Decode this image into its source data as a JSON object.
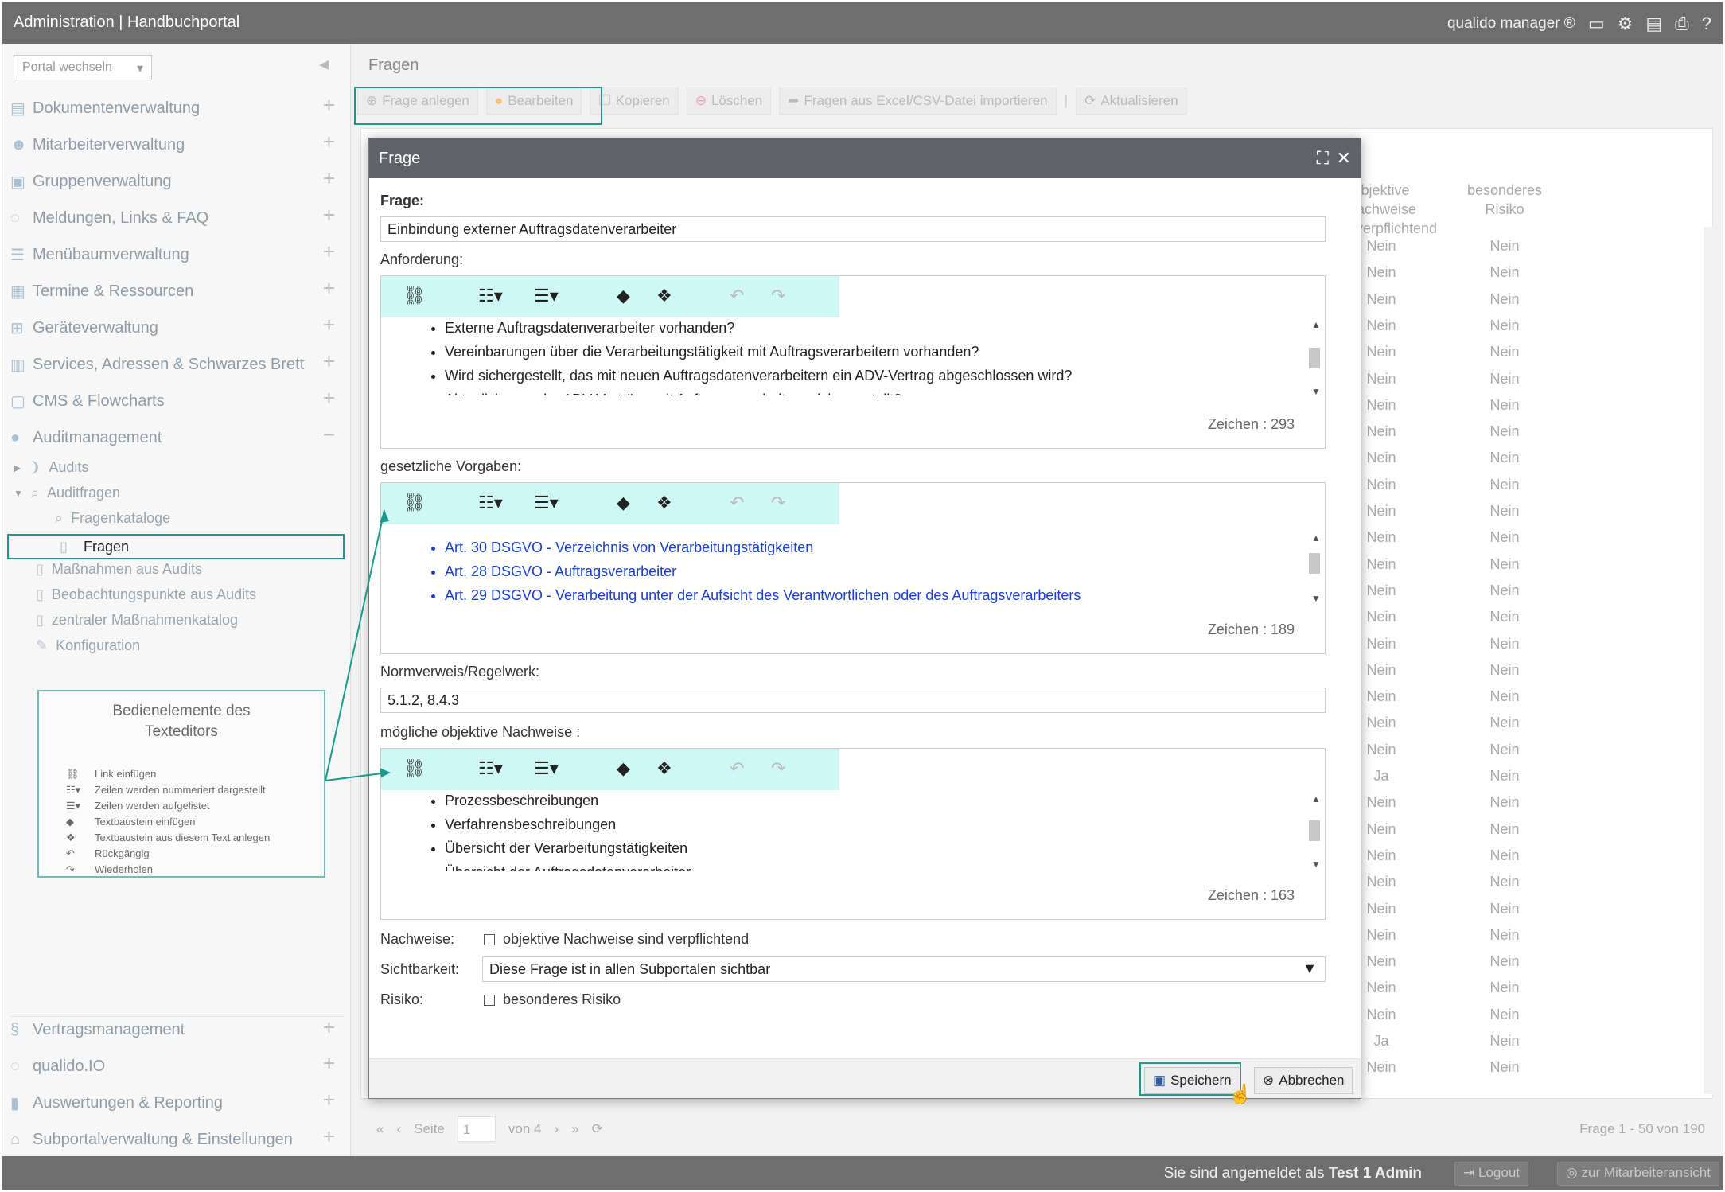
{
  "topbar": {
    "title": "Administration | Handbuchportal",
    "brand": "qualido manager ®"
  },
  "sidebar": {
    "portal_select": "Portal wechseln",
    "items": [
      {
        "label": "Dokumentenverwaltung"
      },
      {
        "label": "Mitarbeiterverwaltung"
      },
      {
        "label": "Gruppenverwaltung"
      },
      {
        "label": "Meldungen, Links & FAQ"
      },
      {
        "label": "Menübaumverwaltung"
      },
      {
        "label": "Termine & Ressourcen"
      },
      {
        "label": "Geräteverwaltung"
      },
      {
        "label": "Services, Adressen & Schwarzes Brett"
      },
      {
        "label": "CMS & Flowcharts"
      },
      {
        "label": "Auditmanagement"
      }
    ],
    "subitems": [
      {
        "label": "Audits"
      },
      {
        "label": "Auditfragen"
      },
      {
        "label": "Fragenkataloge"
      },
      {
        "label": "Fragen"
      },
      {
        "label": "Maßnahmen aus Audits"
      },
      {
        "label": "Beobachtungspunkte aus Audits"
      },
      {
        "label": "zentraler Maßnahmenkatalog"
      },
      {
        "label": "Konfiguration"
      }
    ],
    "bottom_items": [
      {
        "label": "Vertragsmanagement"
      },
      {
        "label": "qualido.IO"
      },
      {
        "label": "Auswertungen & Reporting"
      },
      {
        "label": "Subportalverwaltung & Einstellungen"
      }
    ]
  },
  "legend": {
    "title_line1": "Bedienelemente des",
    "title_line2": "Texteditors",
    "entries": [
      "Link einfügen",
      "Zeilen werden nummeriert dargestellt",
      "Zeilen werden aufgelistet",
      "Textbaustein einfügen",
      "Textbaustein aus diesem Text anlegen",
      "Rückgängig",
      "Wiederholen"
    ]
  },
  "main": {
    "page_title": "Fragen",
    "toolbar": {
      "create": "Frage anlegen",
      "edit": "Bearbeiten",
      "copy": "Kopieren",
      "delete": "Löschen",
      "import": "Fragen aus Excel/CSV-Datei importieren",
      "refresh": "Aktualisieren"
    },
    "grid": {
      "col_evidence_1": "objektive Nachweise",
      "col_evidence_2": "sind verpflichtend",
      "col_risk_1": "besonderes",
      "col_risk_2": "Risiko",
      "rows": [
        [
          "Nein",
          "Nein"
        ],
        [
          "Nein",
          "Nein"
        ],
        [
          "Nein",
          "Nein"
        ],
        [
          "Nein",
          "Nein"
        ],
        [
          "Nein",
          "Nein"
        ],
        [
          "Nein",
          "Nein"
        ],
        [
          "Nein",
          "Nein"
        ],
        [
          "Nein",
          "Nein"
        ],
        [
          "Nein",
          "Nein"
        ],
        [
          "Nein",
          "Nein"
        ],
        [
          "Nein",
          "Nein"
        ],
        [
          "Nein",
          "Nein"
        ],
        [
          "Nein",
          "Nein"
        ],
        [
          "Nein",
          "Nein"
        ],
        [
          "Nein",
          "Nein"
        ],
        [
          "Nein",
          "Nein"
        ],
        [
          "Nein",
          "Nein"
        ],
        [
          "Nein",
          "Nein"
        ],
        [
          "Nein",
          "Nein"
        ],
        [
          "Nein",
          "Nein"
        ],
        [
          "Ja",
          "Nein"
        ],
        [
          "Nein",
          "Nein"
        ],
        [
          "Nein",
          "Nein"
        ],
        [
          "Nein",
          "Nein"
        ],
        [
          "Nein",
          "Nein"
        ],
        [
          "Nein",
          "Nein"
        ],
        [
          "Nein",
          "Nein"
        ],
        [
          "Nein",
          "Nein"
        ],
        [
          "Nein",
          "Nein"
        ],
        [
          "Nein",
          "Nein"
        ],
        [
          "Ja",
          "Nein"
        ],
        [
          "Nein",
          "Nein"
        ]
      ]
    },
    "pager": {
      "page_label": "Seite",
      "page": "1",
      "of": "von 4",
      "info": "Frage 1 - 50 von 190"
    }
  },
  "dialog": {
    "title": "Frage",
    "frage_label": "Frage:",
    "frage_value": "Einbindung externer Auftragsdatenverarbeiter",
    "anforderung_label": "Anforderung:",
    "anforderung_items": [
      "Externe Auftragsdatenverarbeiter vorhanden?",
      "Vereinbarungen über die Verarbeitungstätigkeit mit Auftragsverarbeitern vorhanden?",
      "Wird sichergestellt, das mit neuen Auftragsdatenverarbeitern ein ADV-Vertrag abgeschlossen wird?",
      "Aktualisierung der ADV-Verträge mit Auftragsverarbeitern sichergestellt?"
    ],
    "anforderung_count": "Zeichen : 293",
    "vorgaben_label": "gesetzliche Vorgaben:",
    "vorgaben_items": [
      "Art. 30 DSGVO - Verzeichnis von Verarbeitungstätigkeiten",
      "Art. 28 DSGVO - Auftragsverarbeiter",
      "Art. 29 DSGVO - Verarbeitung unter der Aufsicht des Verantwortlichen oder des Auftragsverarbeiters"
    ],
    "vorgaben_count": "Zeichen : 189",
    "norm_label": "Normverweis/Regelwerk:",
    "norm_value": "5.1.2, 8.4.3",
    "nachweise_label": "mögliche objektive Nachweise :",
    "nachweise_items": [
      "Prozessbeschreibungen",
      "Verfahrensbeschreibungen",
      "Übersicht der Verarbeitungstätigkeiten",
      "Übersicht der Auftragsdatenverarbeiter"
    ],
    "nachweise_count": "Zeichen : 163",
    "nachweise_row_label": "Nachweise:",
    "nachweise_checkbox": "objektive Nachweise sind verpflichtend",
    "sichtbarkeit_label": "Sichtbarkeit:",
    "sichtbarkeit_value": "Diese Frage ist in allen Subportalen sichtbar",
    "risiko_label": "Risiko:",
    "risiko_checkbox": "besonderes Risiko",
    "save": "Speichern",
    "cancel": "Abbrechen"
  },
  "footer": {
    "user_text": "Sie sind angemeldet als",
    "user_name": "Test 1 Admin",
    "logout": "Logout",
    "switch_view": "zur Mitarbeiteransicht"
  },
  "colors": {
    "highlight": "#1a9a8c",
    "editor_toolbar": "#cff7f3",
    "link": "#1a3ed0"
  }
}
